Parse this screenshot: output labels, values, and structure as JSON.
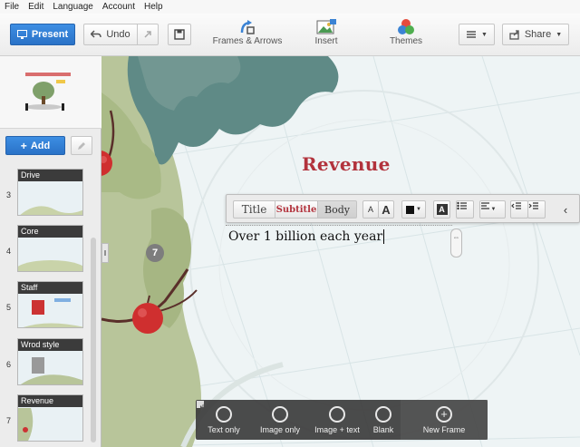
{
  "menu": [
    "File",
    "Edit",
    "Language",
    "Account",
    "Help"
  ],
  "toolbar": {
    "present": "Present",
    "undo": "Undo",
    "frames_arrows": "Frames & Arrows",
    "insert": "Insert",
    "themes": "Themes",
    "share": "Share"
  },
  "sidebar": {
    "add": "Add",
    "slides": [
      {
        "num": "3",
        "label": "Drive"
      },
      {
        "num": "4",
        "label": "Core"
      },
      {
        "num": "5",
        "label": "Staff"
      },
      {
        "num": "6",
        "label": "Wrod style"
      },
      {
        "num": "7",
        "label": "Revenue"
      }
    ]
  },
  "canvas": {
    "title": "Revenue",
    "path_step": "7",
    "text_content": "Over 1 billion each year"
  },
  "format_bar": {
    "styles": [
      "Title",
      "Subtitle",
      "Body"
    ],
    "active_style": "Body",
    "font_size_down": "A",
    "font_size_up": "A",
    "highlight": "A",
    "text_color": "#111111"
  },
  "layout_bar": {
    "options": [
      "Text only",
      "Image only",
      "Image + text",
      "Blank",
      "New Frame"
    ]
  },
  "colors": {
    "accent_blue": "#2f7fd8",
    "title_red": "#b2323c",
    "tree_green": "#b8c59a",
    "leaf_teal": "#5f8a86"
  }
}
